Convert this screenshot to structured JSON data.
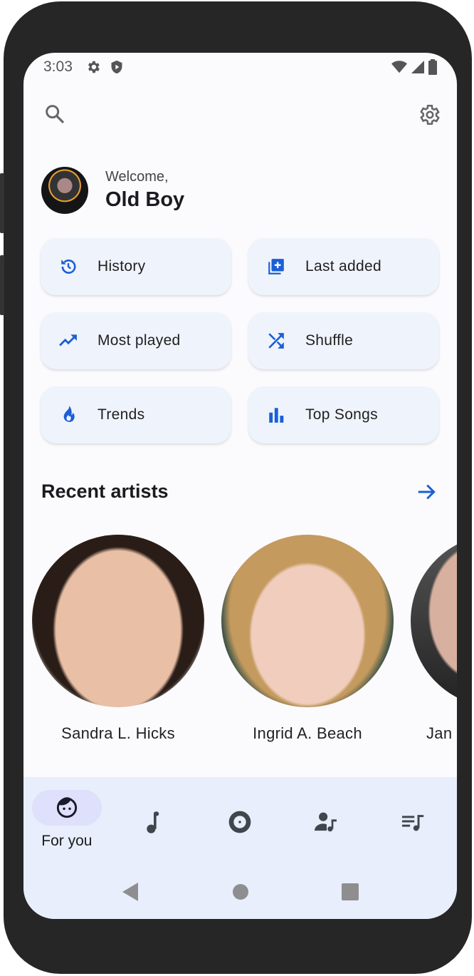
{
  "status_bar": {
    "time": "3:03",
    "icons": [
      "settings-icon",
      "shield-icon",
      "wifi-icon",
      "signal-icon",
      "battery-icon"
    ]
  },
  "header": {
    "search_icon": "search-icon",
    "settings_icon": "gear-icon"
  },
  "welcome": {
    "greeting": "Welcome,",
    "name": "Old Boy"
  },
  "quick_actions": [
    {
      "label": "History",
      "icon": "history-icon"
    },
    {
      "label": "Last added",
      "icon": "library-add-icon"
    },
    {
      "label": "Most played",
      "icon": "trending-up-icon"
    },
    {
      "label": "Shuffle",
      "icon": "shuffle-icon"
    },
    {
      "label": "Trends",
      "icon": "fire-icon"
    },
    {
      "label": "Top Songs",
      "icon": "bar-chart-icon"
    }
  ],
  "recent_artists": {
    "title": "Recent artists",
    "artists": [
      {
        "name": "Sandra L. Hicks"
      },
      {
        "name": "Ingrid A. Beach"
      },
      {
        "name": "Jan"
      }
    ]
  },
  "bottom_nav": {
    "items": [
      {
        "label": "For you",
        "icon": "face-icon",
        "active": true
      },
      {
        "icon": "music-note-icon"
      },
      {
        "icon": "album-icon"
      },
      {
        "icon": "artist-icon"
      },
      {
        "icon": "playlist-icon"
      }
    ]
  },
  "colors": {
    "accent": "#1a5fd6",
    "card_bg": "#eff3fb",
    "nav_bg": "#e8eefb",
    "active_pill": "#dfe0fb"
  }
}
